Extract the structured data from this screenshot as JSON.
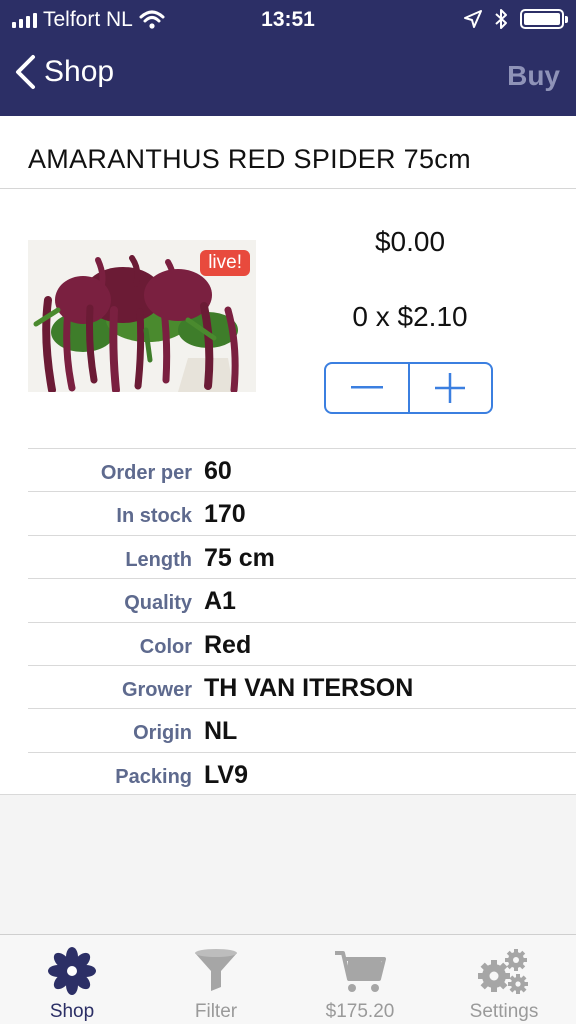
{
  "status": {
    "carrier": "Telfort NL",
    "time": "13:51"
  },
  "nav": {
    "back_label": "Shop",
    "buy_label": "Buy"
  },
  "product": {
    "title": "AMARANTHUS RED SPIDER 75cm",
    "badge": "live!",
    "total": "$0.00",
    "unit_price": "0 x $2.10"
  },
  "details": [
    {
      "label": "Order per",
      "value": "60"
    },
    {
      "label": "In stock",
      "value": "170"
    },
    {
      "label": "Length",
      "value": "75 cm"
    },
    {
      "label": "Quality",
      "value": "A1"
    },
    {
      "label": "Color",
      "value": "Red"
    },
    {
      "label": "Grower",
      "value": "TH VAN ITERSON"
    },
    {
      "label": "Origin",
      "value": "NL"
    },
    {
      "label": "Packing",
      "value": "LV9"
    }
  ],
  "tabs": [
    {
      "label": "Shop",
      "icon": "flower-icon",
      "active": true
    },
    {
      "label": "Filter",
      "icon": "funnel-icon",
      "active": false
    },
    {
      "label": "$175.20",
      "icon": "cart-icon",
      "active": false
    },
    {
      "label": "Settings",
      "icon": "gears-icon",
      "active": false
    }
  ],
  "colors": {
    "nav_background": "#2c2f66",
    "accent_blue": "#3b7fe0",
    "label_gray_blue": "#5e6a8e",
    "live_badge": "#e84a3d"
  }
}
